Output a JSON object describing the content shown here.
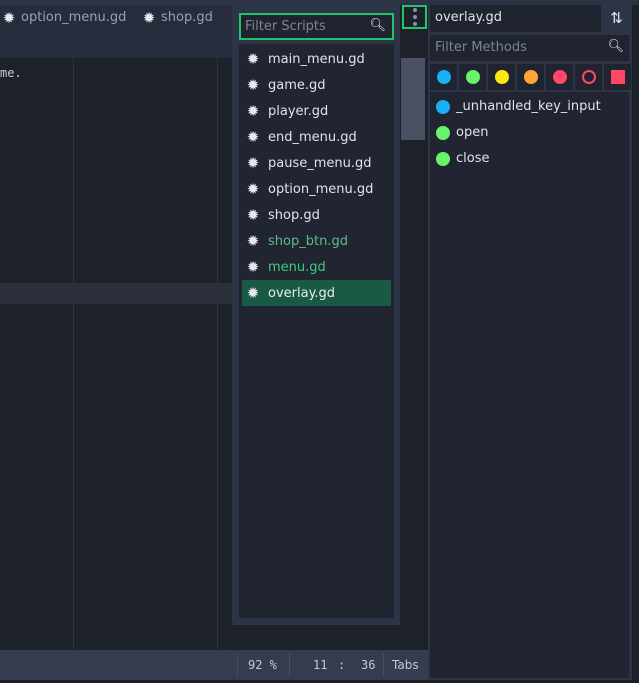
{
  "tabs": [
    {
      "label": "option_menu.gd",
      "icon": "gear-icon"
    },
    {
      "label": "shop.gd",
      "icon": "gear-icon"
    }
  ],
  "code": {
    "visible_text": "me."
  },
  "scripts": {
    "filter_placeholder": "Filter Scripts",
    "items": [
      {
        "label": "main_menu.gd",
        "color": "#e0e3ea"
      },
      {
        "label": "game.gd",
        "color": "#e0e3ea"
      },
      {
        "label": "player.gd",
        "color": "#e0e3ea"
      },
      {
        "label": "end_menu.gd",
        "color": "#e0e3ea"
      },
      {
        "label": "pause_menu.gd",
        "color": "#e0e3ea"
      },
      {
        "label": "option_menu.gd",
        "color": "#e0e3ea"
      },
      {
        "label": "shop.gd",
        "color": "#e0e3ea"
      },
      {
        "label": "shop_btn.gd",
        "color": "#5fb98f"
      },
      {
        "label": "menu.gd",
        "color": "#3ccf7a"
      },
      {
        "label": "overlay.gd",
        "color": "#e8ebf0",
        "selected": true
      }
    ]
  },
  "methods": {
    "current_script": "overlay.gd",
    "filter_placeholder": "Filter Methods",
    "filter_colors": [
      "#19b0f7",
      "#6bf26b",
      "#ffe712",
      "#ffa53a",
      "#ff4766",
      "ring:#ff4766",
      "square:#ff4766"
    ],
    "items": [
      {
        "label": "_unhandled_key_input",
        "color": "#19b0f7"
      },
      {
        "label": "open",
        "color": "#6bf26b"
      },
      {
        "label": "close",
        "color": "#6bf26b"
      }
    ]
  },
  "status": {
    "zoom": "92 %",
    "line": "11",
    "sep": ":",
    "col": "36",
    "indent": "Tabs"
  }
}
